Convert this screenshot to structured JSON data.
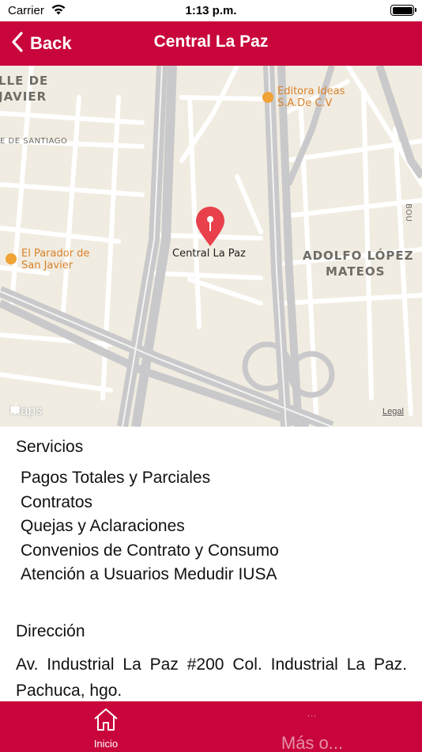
{
  "status_bar": {
    "carrier": "Carrier",
    "time": "1:13 p.m."
  },
  "nav": {
    "back_label": "Back",
    "title": "Central La Paz"
  },
  "map": {
    "areas": [
      "LLE DE",
      "JAVIER",
      "ADOLFO LÓPEZ",
      "MATEOS"
    ],
    "streets": [
      "E DE SANTIAGO",
      "BOU"
    ],
    "pois": [
      {
        "name_line1": "Editora Ideas",
        "name_line2": "S.A.De C.V",
        "icon": "shopping-bag-icon"
      },
      {
        "name_line1": "El Parador de",
        "name_line2": "San Javier",
        "icon": "restaurant-icon"
      }
    ],
    "pin_label": "Central La Paz",
    "pin_icon": "location-pin-icon",
    "logo_text": "Maps",
    "legal": "Legal"
  },
  "services": {
    "title": "Servicios",
    "items": [
      "Pagos Totales y Parciales",
      "Contratos",
      "Quejas y Aclaraciones",
      "Convenios de Contrato y Consumo",
      "Atención a Usuarios Medudir IUSA"
    ]
  },
  "address": {
    "title": "Dirección",
    "text": "Av. Industrial La Paz #200 Col. Industrial La Paz. Pachuca, hgo."
  },
  "tab_bar": {
    "home_label": "Inicio",
    "home_icon": "home-icon",
    "more_dots": "...",
    "more_label": "Más o..."
  },
  "colors": {
    "brand": "#c8063c",
    "map_background": "#f1ece1",
    "road": "#ffffff",
    "highway": "#c9c9cb",
    "pin": "#e8414c",
    "poi": "#f0a234"
  }
}
